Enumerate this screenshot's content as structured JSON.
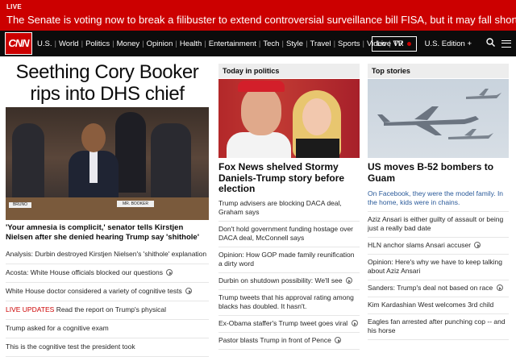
{
  "live_bar": {
    "label": "LIVE",
    "text": "The Senate is voting now to break a filibuster to extend controversial surveillance bill FISA, but it may fall short"
  },
  "nav": {
    "logo": "CNN",
    "links": [
      "U.S.",
      "World",
      "Politics",
      "Money",
      "Opinion",
      "Health",
      "Entertainment",
      "Tech",
      "Style",
      "Travel",
      "Sports",
      "Video",
      "VR"
    ],
    "live_tv": "Live TV",
    "edition": "U.S. Edition +"
  },
  "col1": {
    "headline": "Seething Cory Booker rips into DHS chief",
    "hero_nameplate": "MR. BOOKER",
    "hero_nameplate2": "BRUNO",
    "caption": "'Your amnesia is complicit,' senator tells Kirstjen Nielsen after she denied hearing Trump say 'shithole'",
    "items": [
      {
        "prefix": "",
        "text": "Analysis: Durbin destroyed Kirstjen Nielsen's 'shithole' explanation",
        "video": false
      },
      {
        "prefix": "",
        "text": "Acosta: White House officials blocked our questions",
        "video": true
      },
      {
        "prefix": "",
        "text": "White House doctor considered a variety of cognitive tests",
        "video": true
      },
      {
        "prefix": "LIVE UPDATES",
        "text": "Read the report on Trump's physical",
        "video": false
      },
      {
        "prefix": "",
        "text": "Trump asked for a cognitive exam",
        "video": false
      },
      {
        "prefix": "",
        "text": "This is the cognitive test the president took",
        "video": false
      }
    ]
  },
  "col2": {
    "section": "Today in politics",
    "title": "Fox News shelved Stormy Daniels-Trump story before election",
    "items": [
      {
        "text": "Trump advisers are blocking DACA deal, Graham says",
        "video": false
      },
      {
        "text": "Don't hold government funding hostage over DACA deal, McConnell says",
        "video": false
      },
      {
        "text": "Opinion: How GOP made family reunification a dirty word",
        "video": false
      },
      {
        "text": "Durbin on shutdown possibility: We'll see",
        "video": true
      },
      {
        "text": "Trump tweets that his approval rating among blacks has doubled. It hasn't.",
        "video": false
      },
      {
        "text": "Ex-Obama staffer's Trump tweet goes viral",
        "video": true
      },
      {
        "text": "Pastor blasts Trump in front of Pence",
        "video": true
      }
    ]
  },
  "col3": {
    "section": "Top stories",
    "title": "US moves B-52 bombers to Guam",
    "items": [
      {
        "text": "On Facebook, they were the model family. In the home, kids were in chains.",
        "video": false,
        "blue": true
      },
      {
        "text": "Aziz Ansari is either guilty of assault or being just a really bad date",
        "video": false,
        "blue": false
      },
      {
        "text": "HLN anchor slams Ansari accuser",
        "video": true,
        "blue": false
      },
      {
        "text": "Opinion: Here's why we have to keep talking about Aziz Ansari",
        "video": false,
        "blue": false
      },
      {
        "text": "Sanders: Trump's deal not based on race",
        "video": true,
        "blue": false
      },
      {
        "text": "Kim Kardashian West welcomes 3rd child",
        "video": false,
        "blue": false
      },
      {
        "text": "Eagles fan arrested after punching cop -- and his horse",
        "video": false,
        "blue": false
      }
    ]
  },
  "colors": {
    "brand_red": "#cc0000",
    "nav_bg": "#0c0c0c",
    "link_blue": "#2a5a9a"
  }
}
